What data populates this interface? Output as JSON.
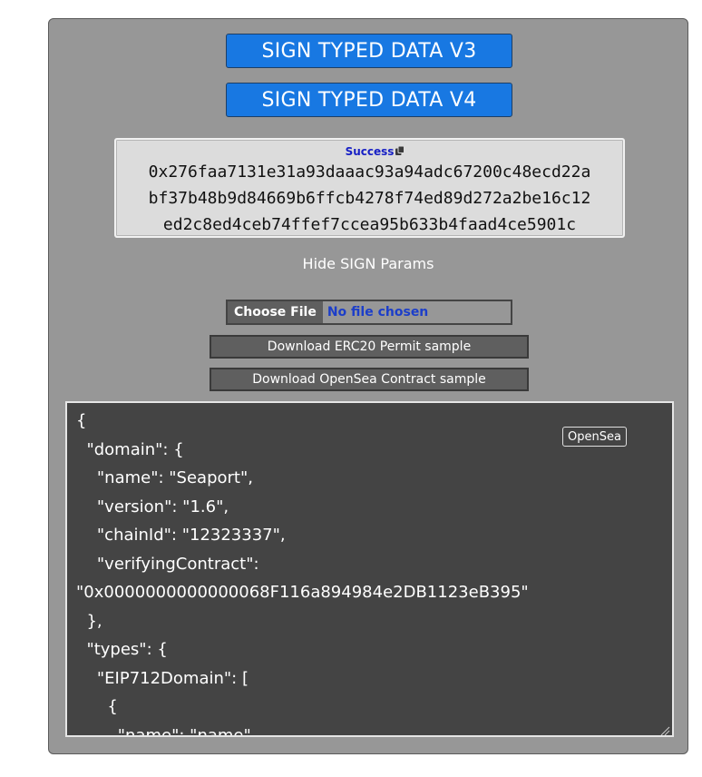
{
  "buttons": {
    "sign_v3": "SIGN TYPED DATA V3",
    "sign_v4": "SIGN TYPED DATA V4"
  },
  "result": {
    "status": "Success",
    "copy_icon": "copy-icon",
    "signature_lines": [
      "0x276faa7131e31a93daaac93a94adc67200c48ecd22a",
      "bf37b48b9d84669b6ffcb4278f74ed89d272a2be16c12",
      "ed2c8ed4ceb74ffef7ccea95b633b4faad4ce5901c"
    ]
  },
  "toggle_params_label": "Hide SIGN Params",
  "file_input": {
    "button_label": "Choose File",
    "status": "No file chosen"
  },
  "downloads": {
    "erc20": "Download ERC20 Permit sample",
    "opensea": "Download OpenSea Contract sample"
  },
  "editor": {
    "badge": "OpenSea",
    "content": "{\n  \"domain\": {\n    \"name\": \"Seaport\",\n    \"version\": \"1.6\",\n    \"chainId\": \"12323337\",\n    \"verifyingContract\":\n\"0x0000000000000068F116a894984e2DB1123eB395\"\n  },\n  \"types\": {\n    \"EIP712Domain\": [\n      {\n        \"name\": \"name\","
  },
  "colors": {
    "panel_bg": "#979797",
    "accent_button": "#1878e2",
    "success_text": "#1720c5",
    "editor_bg": "#444444"
  }
}
